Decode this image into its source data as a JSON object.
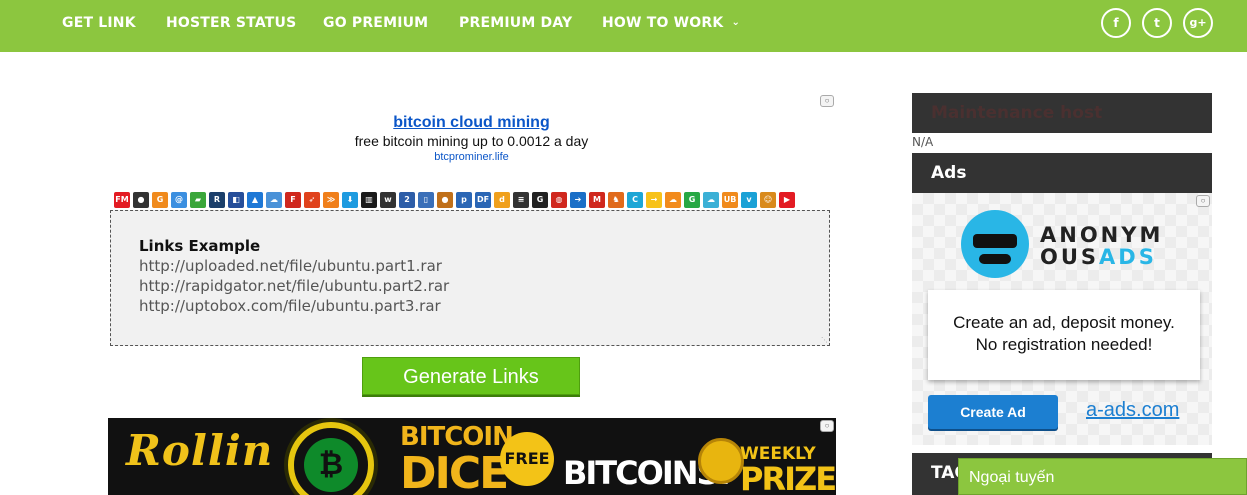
{
  "nav": {
    "items": [
      "GET LINK",
      "HOSTER STATUS",
      "GO PREMIUM",
      "PREMIUM DAY",
      "HOW TO WORK"
    ],
    "social": [
      {
        "name": "facebook",
        "glyph": "f"
      },
      {
        "name": "twitter",
        "glyph": "t"
      },
      {
        "name": "google-plus",
        "glyph": "g+"
      }
    ]
  },
  "ad": {
    "title": "bitcoin cloud mining",
    "description": "free bitcoin mining up to 0.0012 a day",
    "url": "btcprominer.life"
  },
  "hosts": [
    {
      "glyph": "FM",
      "color": "#e31b23"
    },
    {
      "glyph": "●",
      "color": "#333333"
    },
    {
      "glyph": "G",
      "color": "#f08a1c"
    },
    {
      "glyph": "@",
      "color": "#3b8fe0"
    },
    {
      "glyph": "▰",
      "color": "#3aa63a"
    },
    {
      "glyph": "R",
      "color": "#1b3f6b"
    },
    {
      "glyph": "◧",
      "color": "#264e9a"
    },
    {
      "glyph": "▲",
      "color": "#1e78d6"
    },
    {
      "glyph": "☁",
      "color": "#4a92d8"
    },
    {
      "glyph": "F",
      "color": "#d0271d"
    },
    {
      "glyph": "➶",
      "color": "#e0421c"
    },
    {
      "glyph": "≫",
      "color": "#f07f1a"
    },
    {
      "glyph": "⬇",
      "color": "#1e9be0"
    },
    {
      "glyph": "▥",
      "color": "#1b1b1b"
    },
    {
      "glyph": "w",
      "color": "#333333"
    },
    {
      "glyph": "2",
      "color": "#2d5da8"
    },
    {
      "glyph": "▯",
      "color": "#3a6fb8"
    },
    {
      "glyph": "●",
      "color": "#c0701a"
    },
    {
      "glyph": "p",
      "color": "#2a66b5"
    },
    {
      "glyph": "DF",
      "color": "#2a66b5"
    },
    {
      "glyph": "d",
      "color": "#f0a01c"
    },
    {
      "glyph": "≡",
      "color": "#333333"
    },
    {
      "glyph": "G",
      "color": "#222222"
    },
    {
      "glyph": "◍",
      "color": "#d0271d"
    },
    {
      "glyph": "➔",
      "color": "#1b6fc7"
    },
    {
      "glyph": "M",
      "color": "#d0271d"
    },
    {
      "glyph": "♞",
      "color": "#e06a1c"
    },
    {
      "glyph": "C",
      "color": "#1ca6d6"
    },
    {
      "glyph": "→",
      "color": "#f7c21a"
    },
    {
      "glyph": "☁",
      "color": "#f28b1c"
    },
    {
      "glyph": "G",
      "color": "#27a844"
    },
    {
      "glyph": "☁",
      "color": "#3bb0d6"
    },
    {
      "glyph": "UB",
      "color": "#f08a1c"
    },
    {
      "glyph": "v",
      "color": "#1aa1d6"
    },
    {
      "glyph": "☺",
      "color": "#d98a1c"
    },
    {
      "glyph": "▶",
      "color": "#e31b23"
    }
  ],
  "links_box": {
    "heading": "Links Example",
    "lines": [
      "http://uploaded.net/file/ubuntu.part1.rar",
      "http://rapidgator.net/file/ubuntu.part2.rar",
      "http://uptobox.com/file/ubuntu.part3.rar"
    ]
  },
  "generate_button": "Generate Links",
  "banner": {
    "brand": "Rollin",
    "coin_glyph": "₿",
    "line1": "BITCOIN",
    "line2": "DICE",
    "free": "FREE",
    "bitcoins": "BITCOINS!",
    "weekly": "WEEKLY",
    "prizes": "PRIZES"
  },
  "sidebar": {
    "maintenance_title": "Maintenance host",
    "maintenance_value": "N/A",
    "ads_title": "Ads",
    "tags_title": "TAG"
  },
  "anon_ads": {
    "brand_line1": "ANONYM",
    "brand_line2a": "OUS",
    "brand_line2b": "ADS",
    "card_line1": "Create an ad, deposit money.",
    "card_line2": "No registration needed!",
    "create_button": "Create Ad",
    "link": "a-ads.com"
  },
  "chat": {
    "status": "Ngoại tuyến"
  },
  "colors": {
    "nav_bg": "#8cc63f",
    "button_green": "#67c51a",
    "sidebar_head": "#333333",
    "accent_blue": "#1c7fd1"
  }
}
